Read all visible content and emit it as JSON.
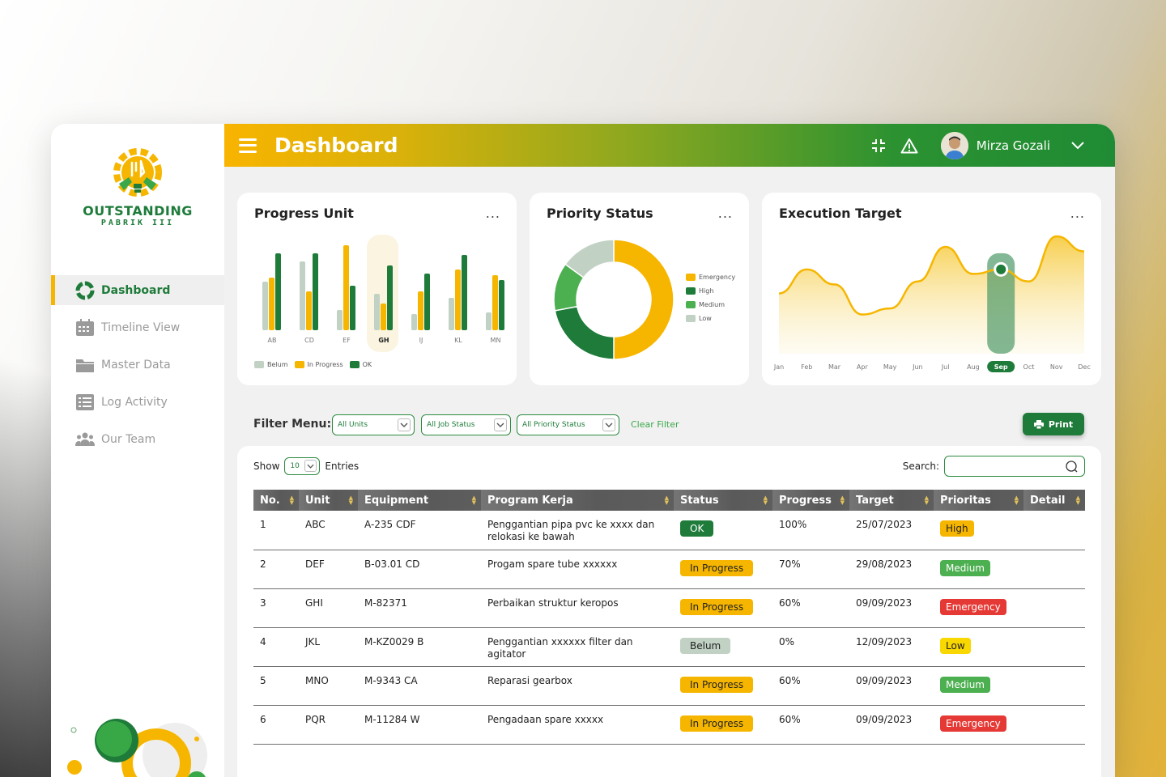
{
  "app": {
    "brand_title": "OUTSTANDING",
    "brand_subtitle": "PABRIK III"
  },
  "header": {
    "title": "Dashboard",
    "user_name": "Mirza Gozali"
  },
  "sidebar": {
    "items": [
      {
        "label": "Dashboard",
        "icon": "dashboard-icon",
        "active": true
      },
      {
        "label": "Timeline View",
        "icon": "calendar-icon",
        "active": false
      },
      {
        "label": "Master Data",
        "icon": "folder-icon",
        "active": false
      },
      {
        "label": "Log Activity",
        "icon": "list-icon",
        "active": false
      },
      {
        "label": "Our Team",
        "icon": "team-icon",
        "active": false
      }
    ]
  },
  "colors": {
    "green": "#1e7b3a",
    "yellow": "#f6b600",
    "light": "#c1d1c4",
    "red": "#e53935"
  },
  "cards": {
    "progress_unit": {
      "title": "Progress Unit",
      "menu": "..."
    },
    "priority_status": {
      "title": "Priority Status",
      "menu": "..."
    },
    "execution_target": {
      "title": "Execution Target",
      "menu": "..."
    }
  },
  "chart_data": [
    {
      "type": "bar",
      "title": "Progress Unit",
      "categories": [
        "AB",
        "CD",
        "EF",
        "GH",
        "IJ",
        "KL",
        "MN"
      ],
      "highlighted": "GH",
      "series": [
        {
          "name": "Belum",
          "color": "#c1d1c4",
          "values": [
            60,
            85,
            25,
            45,
            20,
            40,
            22
          ]
        },
        {
          "name": "In Progress",
          "color": "#f6b600",
          "values": [
            65,
            48,
            105,
            33,
            48,
            75,
            68
          ]
        },
        {
          "name": "OK",
          "color": "#1e7b3a",
          "values": [
            95,
            95,
            55,
            80,
            70,
            93,
            62
          ]
        }
      ]
    },
    {
      "type": "pie",
      "title": "Priority Status",
      "donut": true,
      "labels": [
        "Emergency",
        "High",
        "Medium",
        "Low"
      ],
      "values": [
        50,
        22,
        13,
        15
      ],
      "colors": [
        "#f6b600",
        "#1e7b3a",
        "#4caf50",
        "#c1d1c4"
      ]
    },
    {
      "type": "area",
      "title": "Execution Target",
      "categories": [
        "Jan",
        "Feb",
        "Mar",
        "Apr",
        "May",
        "Jun",
        "Jul",
        "Aug",
        "Sep",
        "Oct",
        "Nov",
        "Dec"
      ],
      "values": [
        62,
        78,
        68,
        48,
        52,
        70,
        93,
        75,
        78,
        70,
        100,
        90
      ],
      "highlighted": "Sep",
      "color": "#f6b600"
    }
  ],
  "filter": {
    "label": "Filter Menu:",
    "units": "All Units",
    "job_status": "All Job Status",
    "priority_status": "All Priority Status",
    "clear": "Clear Filter",
    "print": "Print"
  },
  "table": {
    "show_label": "Show",
    "show_value": "10",
    "entries_label": "Entries",
    "search_label": "Search:",
    "search_value": "",
    "columns": [
      "No.",
      "Unit",
      "Equipment",
      "Program Kerja",
      "Status",
      "Progress",
      "Target",
      "Prioritas",
      "Detail"
    ],
    "rows": [
      {
        "no": "1",
        "unit": "ABC",
        "equipment": "A-235 CDF",
        "program": "Penggantian pipa pvc ke xxxx dan relokasi ke bawah",
        "status": "OK",
        "status_type": "ok",
        "progress": "100%",
        "target": "25/07/2023",
        "priority": "High",
        "priority_type": "high"
      },
      {
        "no": "2",
        "unit": "DEF",
        "equipment": "B-03.01 CD",
        "program": "Progam spare tube xxxxxx",
        "status": "In Progress",
        "status_type": "prog",
        "progress": "70%",
        "target": "29/08/2023",
        "priority": "Medium",
        "priority_type": "medium"
      },
      {
        "no": "3",
        "unit": "GHI",
        "equipment": "M-82371",
        "program": "Perbaikan struktur keropos",
        "status": "In Progress",
        "status_type": "prog",
        "progress": "60%",
        "target": "09/09/2023",
        "priority": "Emergency",
        "priority_type": "emergency"
      },
      {
        "no": "4",
        "unit": "JKL",
        "equipment": "M-KZ0029 B",
        "program": "Penggantian xxxxxx filter dan agitator",
        "status": "Belum",
        "status_type": "belum",
        "progress": "0%",
        "target": "12/09/2023",
        "priority": "Low",
        "priority_type": "low"
      },
      {
        "no": "5",
        "unit": "MNO",
        "equipment": "M-9343 CA",
        "program": "Reparasi gearbox",
        "status": "In Progress",
        "status_type": "prog",
        "progress": "60%",
        "target": "09/09/2023",
        "priority": "Medium",
        "priority_type": "medium"
      },
      {
        "no": "6",
        "unit": "PQR",
        "equipment": "M-11284 W",
        "program": "Pengadaan spare xxxxx",
        "status": "In Progress",
        "status_type": "prog",
        "progress": "60%",
        "target": "09/09/2023",
        "priority": "Emergency",
        "priority_type": "emergency"
      }
    ]
  }
}
